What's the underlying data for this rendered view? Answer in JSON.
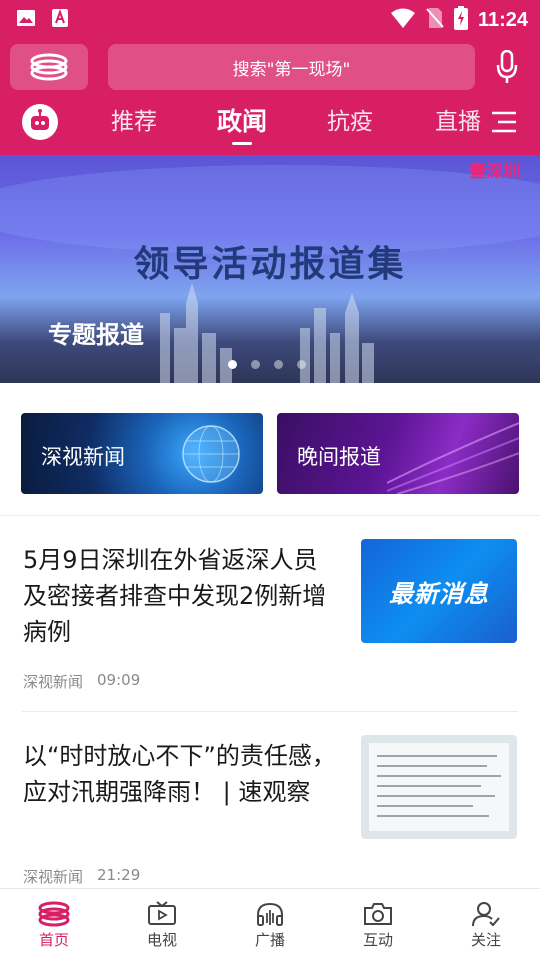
{
  "status_bar": {
    "time": "11:24"
  },
  "search": {
    "placeholder": "搜索\"第一现场\""
  },
  "tabs": [
    {
      "label": "推荐"
    },
    {
      "label": "政闻",
      "active": true
    },
    {
      "label": "抗疫"
    },
    {
      "label": "直播"
    }
  ],
  "banner": {
    "brand": "壹深圳",
    "title": "领导活动报道集",
    "subtitle": "专题报道",
    "page_count": 4,
    "active_page": 1
  },
  "categories": [
    {
      "label": "深视新闻"
    },
    {
      "label": "晚间报道"
    }
  ],
  "news": [
    {
      "title": "5月9日深圳在外省返深人员及密接者排查中发现2例新增病例",
      "source": "深视新闻",
      "time": "09:09",
      "thumb_text": "最新消息"
    },
    {
      "title": "以“时时放心不下”的责任感，应对汛期强降雨！ | 速观察",
      "source": "深视新闻",
      "time": "21:29"
    }
  ],
  "bottom_nav": [
    {
      "label": "首页",
      "icon": "home-logo-icon",
      "active": true
    },
    {
      "label": "电视",
      "icon": "tv-icon"
    },
    {
      "label": "广播",
      "icon": "headphones-icon"
    },
    {
      "label": "互动",
      "icon": "camera-icon"
    },
    {
      "label": "关注",
      "icon": "user-follow-icon"
    }
  ],
  "colors": {
    "brand": "#d81f66"
  }
}
